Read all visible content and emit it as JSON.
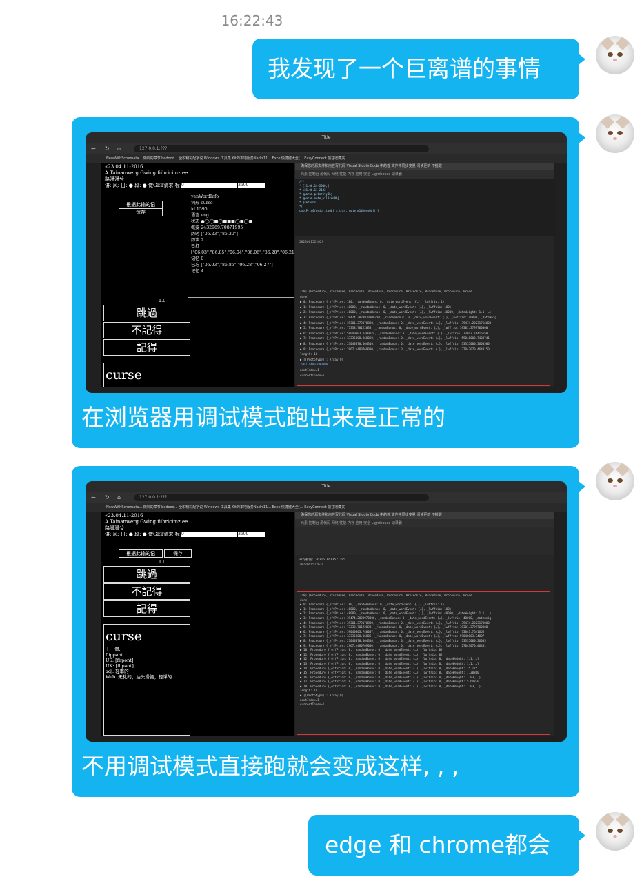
{
  "timestamp": "16:22:43",
  "messages": [
    {
      "text": "我发现了一个巨离谱的事情"
    },
    {
      "caption": "在浏览器用调试模式跑出来是正常的"
    },
    {
      "caption": "不用调试模式直接跑就会变成这样, , ,"
    },
    {
      "text": "edge 和 chrome都会"
    }
  ],
  "screenshot1": {
    "window_title": "Title",
    "url": "127.0.0.1:???",
    "bookmarks": "NewWithSchemata...   随机的章节lbedood...   全职精彩配字说   Windows 工具集   Kit的本地服务Nadrr11...   Excel快捷键大全(...   EasyConnect   前往收藏夹",
    "page": {
      "date_line": "«23.04.11-2016",
      "title_line": "A Tainanwerg Gwing fiihricimz ee",
      "sub_line": "路漫漫兮",
      "controls_line": "讲: 风:  日:  ● 段:  ●  做GET请求  标",
      "input_value": "0",
      "input2_value": "3600",
      "btn_reset": "根据此输的记",
      "btn_save": "保存",
      "popup_title": "yenWordInfo",
      "popup_lines": [
        "词形  curse",
        "id   1595",
        "语言  eng",
        "状态  ●◯◯■◯■■■◯■◯■",
        "概要  2432969.70871995",
        "历时 [\"05.23\",\"85.30\"]",
        "历次 2",
        "已打  [\"06.03\",\"86.85\",\"06.04\",\"06.06\",\"86.20\",\"06.21\"]",
        "记忆 0",
        "已忘  [\"06.03\",\"86.85\",\"06.28\",\"06.27\"]",
        "记忆 4"
      ],
      "counter": "1.0",
      "btn_skip": "跳過",
      "btn_forget": "不記得",
      "btn_remember": "記得",
      "word": "curse"
    },
    "devtools": {
      "infobar": "确保您的源文件和内在写代码 Visual Studio Code 中的首 文件中同步变量   阅读更新   不提醒",
      "tabs": "元素  控制台  源代码  网络  性能  内存  应用  安全  Lighthouse  记录器",
      "code_lines": [
        "/**",
        " * [11.06.14-2046,]",
        " * v21.06.11-2132",
        " * @param priority0bj",
        " * @param note_wil0ren0bj",
        " * @returns",
        " */",
        "calcPrio0(priorityObj = this, note_w1lDren0bj) {"
      ],
      "console_header": "2023061522629",
      "console_lines": [
        "(19) [Procedure, Procedure, Procedure, Procedure, Procedure, Procedure, Procedure, Procedure, Proce",
        " dure]",
        "▶ 0: Procedure {_effPrior: 100, _randomBonus: 0, _date_wordEvent: {…}, _lwffrio: 1}",
        "▶ 1: Procedure {_effPrior: 40000, _randomBonus: 0, _date_wordEvent: {…}, _lwffrio: 100}",
        "▶ 2: Procedure {_effPrior: 40000, _randomBonus: 0, _date_wordEvent: {…}, _lwffrio: 40000, _dateWeight: 1.1, …}",
        "▶ 3: Procedure {_effPrior: 39474.2023970000790, _randomBonus: 0, _date_wordEvent: {…}, _lwffrio: 40000, _dateWeig",
        "▶ 4: Procedure {_effPrior: 39301.379170880, _randomBonus: 0, _date_wordEvent: {…}, _lwffrio: 39474.20231756000",
        "▶ 5: Procedure {_effPrior: 73333.70122038, _randomBonus: 0, _date_wordEvent: {…}, _lwffrio: 39301.3799700000",
        "▶ 6: Procedure {_effPrior: 59040003.7400074, _randomBonus: 0, _date_wordEvent: {…}, _lwffrio: 73043.76416650",
        "▶ 7: Procedure {_effPrior: 33335000.360050, _randomBonus: 0, _date_wordEvent: {…}, _lwffrio: 59040003.7400741",
        "▶ 8: Procedure {_effPrior: 27043070.464310, _randomBonus: 0, _date_wordEvent: {…}, _lwffrio: 33335000.3600500",
        "▶ 9: Procedure {_effPrior: 2967.4480769000, _randomBonus: 0, _date_wordEvent: {…}, _lwffrio: 27043070.4643150",
        "  length: 10",
        "▶ [[Prototype]]: Array(0)",
        "2967.44807690300",
        "nextIndex=1",
        "currentIndex=1"
      ]
    }
  },
  "screenshot2": {
    "window_title": "Title",
    "url": "127.0.0.1:???",
    "page": {
      "date_line": "«23.04.11-2016",
      "title_line": "A Tainanwerg Gwing fiihricimz ee",
      "sub_line": "路漫漫兮",
      "controls_line": "讲: 风:  日:  ● 段:  ●  做GET请求  标",
      "input_value": "0",
      "input2_value": "3600",
      "btn_reset": "根据此输的记",
      "btn_save": "保存",
      "counter": "1.0",
      "btn_skip": "跳過",
      "btn_forget": "不記得",
      "btn_remember": "記得",
      "word": "curse",
      "definition_lines": [
        "上一個:",
        "flippant",
        "US: [flɪpənt]",
        "UK: [flɪpənt]",
        "adj. 轻率的",
        "Web. 无礼的；油头滑脑；轻浮的"
      ]
    },
    "devtools": {
      "console_header": "平均初值: 26316.8613577195",
      "console_sub": "2023061522629",
      "console_lines": [
        "(19) [Procedure, Procedure, Procedure, Procedure, Procedure, Procedure, Procedure, Procedure, Proce",
        " dure]",
        "▶ 0: Procedure {_effPrior: 100, _randomBonus: 0, _date_wordEvent: {…}, _lwffrio: 1}",
        "▶ 1: Procedure {_effPrior: 40000, _randomBonus: 0, _date_wordEvent: {…}, _lwffrio: 100}",
        "▶ 2: Procedure {_effPrior: 40000, _randomBonus: 0, _date_wordEvent: {…}, _lwffrio: 40000, _dateWeight: 1.1, …}",
        "▶ 3: Procedure {_effPrior: 39474.2023970000, _randomBonus: 0, _date_wordEvent: {…}, _lwffrio: 40000, _dateweig",
        "▶ 4: Procedure {_effPrior: 39301.379170880, _randomBonus: 0, _date_wordEvent: {…}, _lwffrio: 39474.2023170000",
        "▶ 5: Procedure {_effPrior: 73333.70122038, _randomBonus: 0, _date_wordEvent: {…}, _lwffrio: 39301.3799700000",
        "▶ 6: Procedure {_effPrior: 59040003.740007, _randomBonus: 0, _date_wordEvent: {…}, _lwffrio: 73043.7641665",
        "▶ 7: Procedure {_effPrior: 33335000.36005, _randomBonus: 0, _date_wordEvent: {…}, _lwffrio: 59040003.74007",
        "▶ 8: Procedure {_effPrior: 27043070.464310, _randomBonus: 0, _date_wordEvent: {…}, _lwffrio: 33335000.36005",
        "▶ 9: Procedure {_effPrior: 2967.4480769000, _randomBonus: 0, _date_wordEvent: {…}, _lwffrio: 27043070.46431",
        "▶ 10: Procedure {_effPrior: 0, _randomBonus: 0, _date_wordEvent: {…}, _lwffrio: 0}",
        "▶ 11: Procedure {_effPrior: 0, _randomBonus: 0, _date_wordEvent: {…}, _lwffrio: 0}",
        "▶ 12: Procedure {_effPrior: 0, _randomBonus: 0, _date_wordEvent: {…}, _lwffrio: 0, _dateWeight: 1.1, …}",
        "▶ 13: Procedure {_effPrior: 0, _randomBonus: 0, _date_wordEvent: {…}, _lwffrio: 0, _dateWeight: 1.1, …}",
        "▶ 14: Procedure {_effPrior: 0, _randomBonus: 0, _date_wordEvent: {…}, _lwffrio: 0, _dateWeight: 15.175",
        "▶ 15: Procedure {_effPrior: 0, _randomBonus: 0, _date_wordEvent: {…}, _lwffrio: 0, _dateWeight: 7.38860",
        "▶ 16: Procedure {_effPrior: 0, _randomBonus: 0, _date_wordEvent: {…}, _lwffrio: 0, _dateWeight: 1.03, …}",
        "▶ 17: Procedure {_effPrior: 0, _randomBonus: 0, _date_wordEvent: {…}, _lwffrio: 0, _dateWeight: 5.64870",
        "▶ 18: Procedure {_effPrior: 0, _randomBonus: 0, _date_wordEvent: {…}, _lwffrio: 0, _dateWeight: 1.03, …}",
        "  length: 19",
        "▶ [[Prototype]]: Array(0)",
        "nextIndex=1",
        "currentIndex=1"
      ]
    }
  }
}
